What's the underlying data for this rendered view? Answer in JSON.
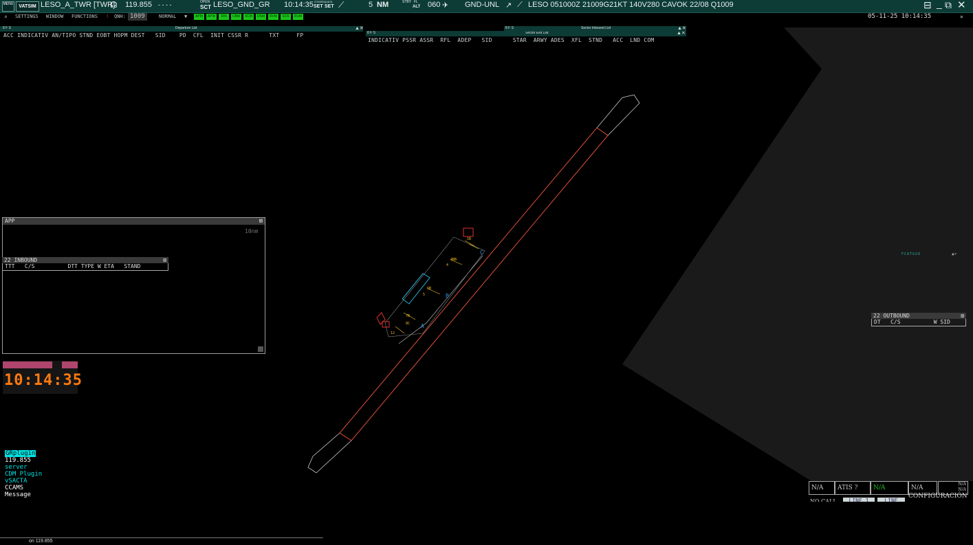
{
  "topbar": {
    "menu_label": "MENU",
    "logo_text": "VATSIM",
    "callsign": "LESO_A_TWR [TWR]",
    "frequency": "119.855",
    "dashes": "-     -     -     -",
    "open_label": "OPEN",
    "sct_label": "SCT",
    "sector_name": "LESO_GND_GR",
    "time": "10:14:35",
    "other_label": "OTHER",
    "quick_label": "QUICK",
    "set_label_1": "SET",
    "set_label_2": "SET",
    "range_value": "5",
    "range_unit": "NM",
    "stby_label": "STBY",
    "fl_label": "FL",
    "alt_label": "ALT",
    "transition_level": "060",
    "level_filter": "GND-UNL",
    "metar": "LESO 051000Z 21009G21KT 140V280 CAVOK 22/08 Q1009"
  },
  "toolbar": {
    "settings": "SETTINGS",
    "window": "WINDOW",
    "functions": "FUNCTIONS",
    "qnh_label": "QNH:",
    "qnh_value": "1009",
    "mode": "NORMAL",
    "green_buttons": [
      "APM",
      "APW",
      "RIN",
      "CBM",
      "SCM",
      "DSM",
      "RVM",
      "SCR",
      "RUM"
    ],
    "datetime": "05-11-25 10:14:35"
  },
  "departure_list": {
    "title": "Departure List",
    "columns": "ACC INDICATIV AN/TIPO STND EOBT HOPM DEST   SID    PD  CFL  INIT CSSR R      TXT     FP"
  },
  "sector_exit_list": {
    "title": "Sector Exit List",
    "columns": "INDICATIV PSSR ASSR  RFL  ADEP   SID      STAR  ARWY ADES  XFL  STND   ACC  LND COM"
  },
  "sector_inbound_list": {
    "title": "Sector Inbound List"
  },
  "app_window": {
    "title": "APP",
    "scale": "10nm"
  },
  "inbound_window": {
    "title": "22 INBOUND",
    "columns": "TTT   C/S          DTT TYPE W ETA   STAND"
  },
  "outbound_window": {
    "title": "22 OUTBOUND",
    "columns": "DT   C/S          W SID"
  },
  "clock": "10:14:35",
  "plugins": [
    "GRplugin",
    "119.855",
    "server",
    "CDM Plugin",
    "vSACTA",
    "CCAMS",
    "Message"
  ],
  "plugin_colors": [
    "#00ffff",
    "#ffffff",
    "#00e5e5",
    "#00e5e5",
    "#00e5e5",
    "#ffffff",
    "#ffffff"
  ],
  "airport_labels": [
    "A",
    "B",
    "C"
  ],
  "stand_labels": [
    "1B",
    "4BB",
    "6B",
    "7B",
    "8C",
    "12",
    "4",
    "5"
  ],
  "right_filter_label": "FCATGSO",
  "bottom_panel": {
    "na_1": "N/A",
    "atis": "ATIS ?",
    "na_green": "N/A",
    "na_2": "N/A",
    "na_small_1": "N/A",
    "na_small_2": "N/A",
    "config": "CONFIGURACIÓN",
    "no_call": "NO CALL",
    "line1": "LINE 1",
    "line2": "LINE"
  },
  "command_line": "on 119.855",
  "colors": {
    "topbar": "#0d3b36",
    "runway": "#e0503a",
    "taxi": "#c8c8c8",
    "terminal": "#2ab4d8",
    "stands": "#f0c020",
    "clock": "#ff7a10",
    "sector_fill": "#1a1a1a"
  }
}
